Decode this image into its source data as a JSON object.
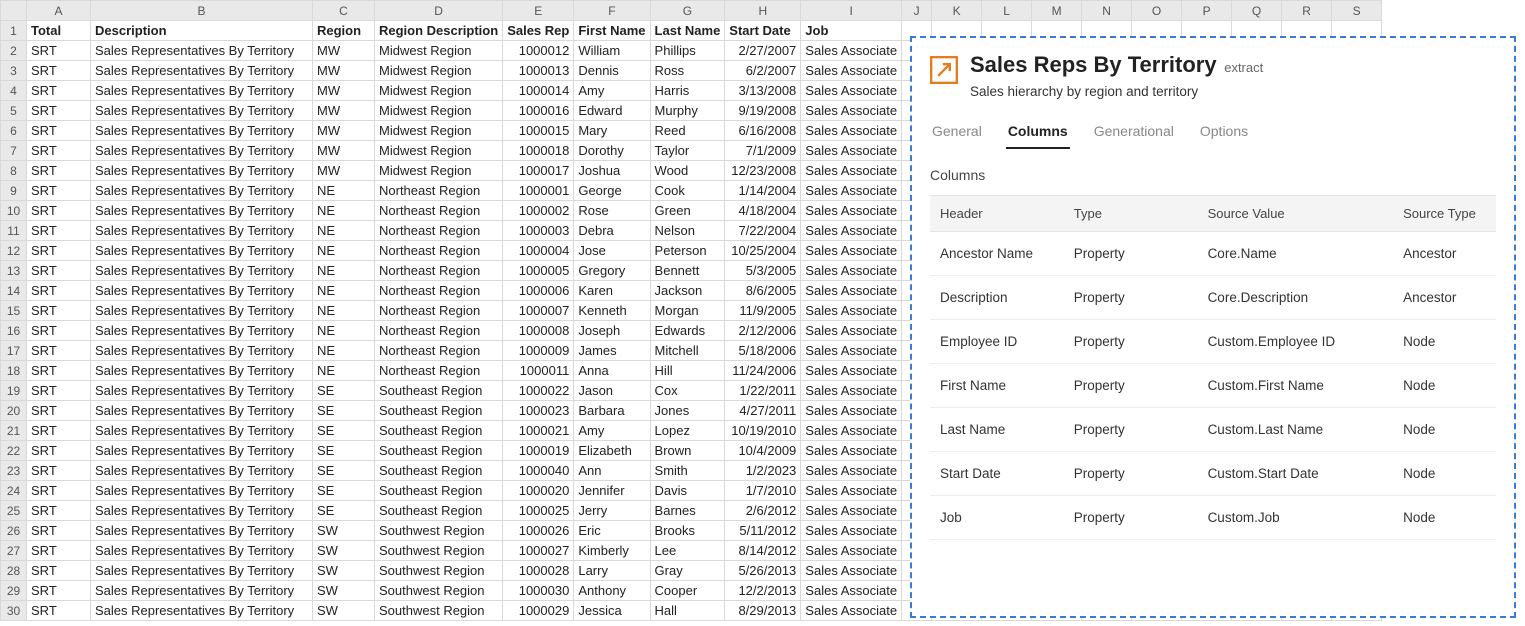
{
  "sheet": {
    "col_letters": [
      "A",
      "B",
      "C",
      "D",
      "E",
      "F",
      "G",
      "H",
      "I",
      "J",
      "K",
      "L",
      "M",
      "N",
      "O",
      "P",
      "Q",
      "R",
      "S"
    ],
    "headers": [
      "Total",
      "Description",
      "Region",
      "Region Description",
      "Sales Rep",
      "First Name",
      "Last Name",
      "Start Date",
      "Job"
    ],
    "rows": [
      [
        "SRT",
        "Sales Representatives By Territory",
        "MW",
        "Midwest Region",
        "1000012",
        "William",
        "Phillips",
        "2/27/2007",
        "Sales Associate"
      ],
      [
        "SRT",
        "Sales Representatives By Territory",
        "MW",
        "Midwest Region",
        "1000013",
        "Dennis",
        "Ross",
        "6/2/2007",
        "Sales Associate"
      ],
      [
        "SRT",
        "Sales Representatives By Territory",
        "MW",
        "Midwest Region",
        "1000014",
        "Amy",
        "Harris",
        "3/13/2008",
        "Sales Associate"
      ],
      [
        "SRT",
        "Sales Representatives By Territory",
        "MW",
        "Midwest Region",
        "1000016",
        "Edward",
        "Murphy",
        "9/19/2008",
        "Sales Associate"
      ],
      [
        "SRT",
        "Sales Representatives By Territory",
        "MW",
        "Midwest Region",
        "1000015",
        "Mary",
        "Reed",
        "6/16/2008",
        "Sales Associate"
      ],
      [
        "SRT",
        "Sales Representatives By Territory",
        "MW",
        "Midwest Region",
        "1000018",
        "Dorothy",
        "Taylor",
        "7/1/2009",
        "Sales Associate"
      ],
      [
        "SRT",
        "Sales Representatives By Territory",
        "MW",
        "Midwest Region",
        "1000017",
        "Joshua",
        "Wood",
        "12/23/2008",
        "Sales Associate"
      ],
      [
        "SRT",
        "Sales Representatives By Territory",
        "NE",
        "Northeast Region",
        "1000001",
        "George",
        "Cook",
        "1/14/2004",
        "Sales Associate"
      ],
      [
        "SRT",
        "Sales Representatives By Territory",
        "NE",
        "Northeast Region",
        "1000002",
        "Rose",
        "Green",
        "4/18/2004",
        "Sales Associate"
      ],
      [
        "SRT",
        "Sales Representatives By Territory",
        "NE",
        "Northeast Region",
        "1000003",
        "Debra",
        "Nelson",
        "7/22/2004",
        "Sales Associate"
      ],
      [
        "SRT",
        "Sales Representatives By Territory",
        "NE",
        "Northeast Region",
        "1000004",
        "Jose",
        "Peterson",
        "10/25/2004",
        "Sales Associate"
      ],
      [
        "SRT",
        "Sales Representatives By Territory",
        "NE",
        "Northeast Region",
        "1000005",
        "Gregory",
        "Bennett",
        "5/3/2005",
        "Sales Associate"
      ],
      [
        "SRT",
        "Sales Representatives By Territory",
        "NE",
        "Northeast Region",
        "1000006",
        "Karen",
        "Jackson",
        "8/6/2005",
        "Sales Associate"
      ],
      [
        "SRT",
        "Sales Representatives By Territory",
        "NE",
        "Northeast Region",
        "1000007",
        "Kenneth",
        "Morgan",
        "11/9/2005",
        "Sales Associate"
      ],
      [
        "SRT",
        "Sales Representatives By Territory",
        "NE",
        "Northeast Region",
        "1000008",
        "Joseph",
        "Edwards",
        "2/12/2006",
        "Sales Associate"
      ],
      [
        "SRT",
        "Sales Representatives By Territory",
        "NE",
        "Northeast Region",
        "1000009",
        "James",
        "Mitchell",
        "5/18/2006",
        "Sales Associate"
      ],
      [
        "SRT",
        "Sales Representatives By Territory",
        "NE",
        "Northeast Region",
        "1000011",
        "Anna",
        "Hill",
        "11/24/2006",
        "Sales Associate"
      ],
      [
        "SRT",
        "Sales Representatives By Territory",
        "SE",
        "Southeast Region",
        "1000022",
        "Jason",
        "Cox",
        "1/22/2011",
        "Sales Associate"
      ],
      [
        "SRT",
        "Sales Representatives By Territory",
        "SE",
        "Southeast Region",
        "1000023",
        "Barbara",
        "Jones",
        "4/27/2011",
        "Sales Associate"
      ],
      [
        "SRT",
        "Sales Representatives By Territory",
        "SE",
        "Southeast Region",
        "1000021",
        "Amy",
        "Lopez",
        "10/19/2010",
        "Sales Associate"
      ],
      [
        "SRT",
        "Sales Representatives By Territory",
        "SE",
        "Southeast Region",
        "1000019",
        "Elizabeth",
        "Brown",
        "10/4/2009",
        "Sales Associate"
      ],
      [
        "SRT",
        "Sales Representatives By Territory",
        "SE",
        "Southeast Region",
        "1000040",
        "Ann",
        "Smith",
        "1/2/2023",
        "Sales Associate"
      ],
      [
        "SRT",
        "Sales Representatives By Territory",
        "SE",
        "Southeast Region",
        "1000020",
        "Jennifer",
        "Davis",
        "1/7/2010",
        "Sales Associate"
      ],
      [
        "SRT",
        "Sales Representatives By Territory",
        "SE",
        "Southeast Region",
        "1000025",
        "Jerry",
        "Barnes",
        "2/6/2012",
        "Sales Associate"
      ],
      [
        "SRT",
        "Sales Representatives By Territory",
        "SW",
        "Southwest Region",
        "1000026",
        "Eric",
        "Brooks",
        "5/11/2012",
        "Sales Associate"
      ],
      [
        "SRT",
        "Sales Representatives By Territory",
        "SW",
        "Southwest Region",
        "1000027",
        "Kimberly",
        "Lee",
        "8/14/2012",
        "Sales Associate"
      ],
      [
        "SRT",
        "Sales Representatives By Territory",
        "SW",
        "Southwest Region",
        "1000028",
        "Larry",
        "Gray",
        "5/26/2013",
        "Sales Associate"
      ],
      [
        "SRT",
        "Sales Representatives By Territory",
        "SW",
        "Southwest Region",
        "1000030",
        "Anthony",
        "Cooper",
        "12/2/2013",
        "Sales Associate"
      ],
      [
        "SRT",
        "Sales Representatives By Territory",
        "SW",
        "Southwest Region",
        "1000029",
        "Jessica",
        "Hall",
        "8/29/2013",
        "Sales Associate"
      ]
    ]
  },
  "panel": {
    "title": "Sales Reps By Territory",
    "subtype": "extract",
    "subtitle": "Sales hierarchy by region and territory",
    "tabs": [
      "General",
      "Columns",
      "Generational",
      "Options"
    ],
    "active_tab": "Columns",
    "section_label": "Columns",
    "columns_table": {
      "headers": [
        "Header",
        "Type",
        "Source Value",
        "Source Type"
      ],
      "rows": [
        [
          "Ancestor Name",
          "Property",
          "Core.Name",
          "Ancestor"
        ],
        [
          "Description",
          "Property",
          "Core.Description",
          "Ancestor"
        ],
        [
          "Employee ID",
          "Property",
          "Custom.Employee ID",
          "Node"
        ],
        [
          "First Name",
          "Property",
          "Custom.First Name",
          "Node"
        ],
        [
          "Last Name",
          "Property",
          "Custom.Last Name",
          "Node"
        ],
        [
          "Start Date",
          "Property",
          "Custom.Start Date",
          "Node"
        ],
        [
          "Job",
          "Property",
          "Custom.Job",
          "Node"
        ]
      ]
    }
  }
}
